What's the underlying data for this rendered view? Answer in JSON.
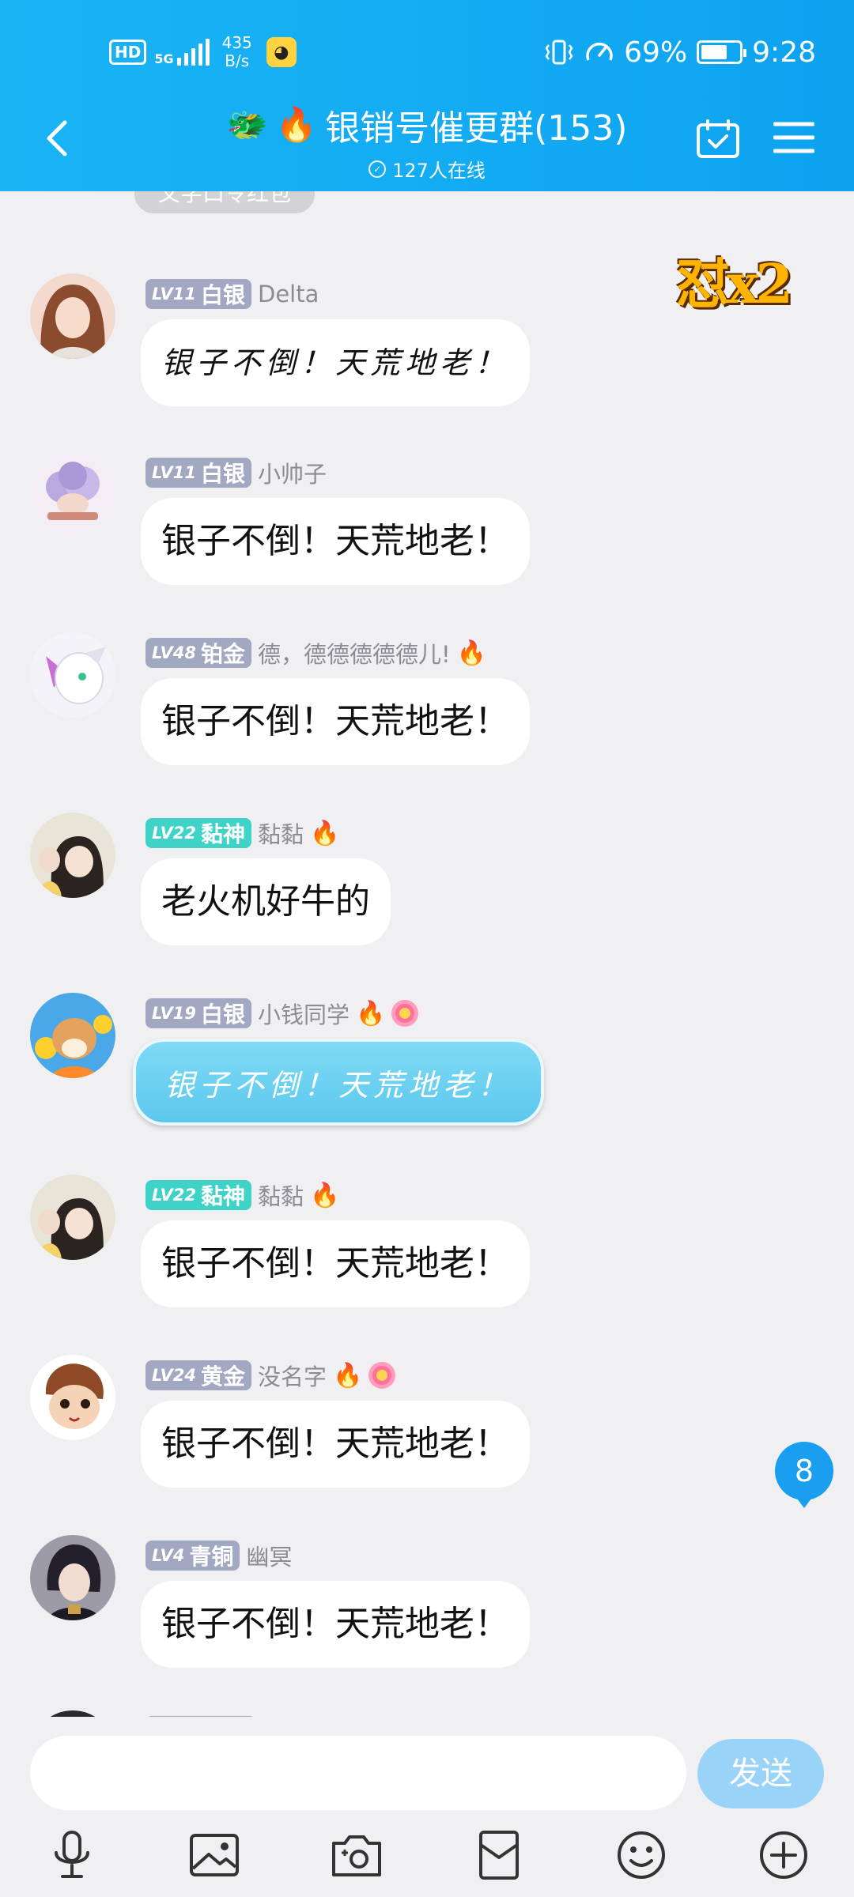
{
  "status_bar": {
    "hd": "HD",
    "network_gen": "5G",
    "network_speed_value": "435",
    "network_speed_unit": "B/s",
    "battery_percent": "69%",
    "battery_level": 0.69,
    "time": "9:28"
  },
  "header": {
    "title": "银销号催更群(153)",
    "online_text": "127人在线"
  },
  "chat": {
    "pinned_chip": "文字口令红包",
    "sticker_text": "怼x2",
    "messages": [
      {
        "level": "LV11",
        "rank": "白银",
        "nickname": "Delta",
        "text": "银子不倒！天荒地老！"
      },
      {
        "level": "LV11",
        "rank": "白银",
        "nickname": "小帅子",
        "text": "银子不倒！天荒地老！"
      },
      {
        "level": "LV48",
        "rank": "铂金",
        "nickname": "德，德德德德德儿!",
        "text": "银子不倒！天荒地老！"
      },
      {
        "level": "LV22",
        "rank": "黏神",
        "nickname": "黏黏",
        "text": "老火机好牛的"
      },
      {
        "level": "LV19",
        "rank": "白银",
        "nickname": "小钱同学",
        "text": "银子不倒！天荒地老！"
      },
      {
        "level": "LV22",
        "rank": "黏神",
        "nickname": "黏黏",
        "text": "银子不倒！天荒地老！"
      },
      {
        "level": "LV24",
        "rank": "黄金",
        "nickname": "没名字",
        "text": "银子不倒！天荒地老！"
      },
      {
        "level": "LV4",
        "rank": "青铜",
        "nickname": "幽冥",
        "text": "银子不倒！天荒地老！"
      }
    ],
    "unread_count": "8"
  },
  "input": {
    "value": "",
    "send_label": "发送"
  },
  "toolbar": {
    "items": [
      "microphone-icon",
      "image-icon",
      "camera-icon",
      "red-packet-icon",
      "emoji-icon",
      "plus-icon"
    ]
  },
  "colors": {
    "header_bg": "#12aaf2",
    "silver_badge": "#a2a8c2",
    "teal_badge": "#3ed3c6",
    "unread_badge": "#1a9ff0",
    "send_button": "#99d3f7"
  }
}
